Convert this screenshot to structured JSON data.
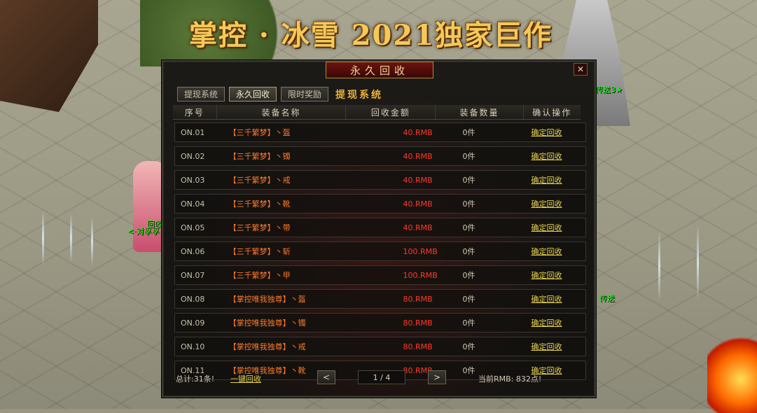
{
  "banner": "掌控 · 冰雪 2021独家巨作",
  "world": {
    "npc_left_label": "<·对孚孚>",
    "npc_left_label2": "回收",
    "npc_right_label": "传送",
    "npc_top_label": "传送3★"
  },
  "dialog": {
    "title": "永久回收",
    "close": "✕",
    "tabs": [
      "提现系统",
      "永久回收",
      "限时奖励"
    ],
    "section_title": "提现系统",
    "columns": [
      "序号",
      "装备名称",
      "回收金额",
      "装备数量",
      "确认操作"
    ],
    "rows": [
      {
        "no": "ON.01",
        "name": "【三千繁梦】丶盔",
        "amount": "40.RMB",
        "qty": "0件",
        "action": "确定回收"
      },
      {
        "no": "ON.02",
        "name": "【三千繁梦】丶镯",
        "amount": "40.RMB",
        "qty": "0件",
        "action": "确定回收"
      },
      {
        "no": "ON.03",
        "name": "【三千繁梦】丶戒",
        "amount": "40.RMB",
        "qty": "0件",
        "action": "确定回收"
      },
      {
        "no": "ON.04",
        "name": "【三千繁梦】丶靴",
        "amount": "40.RMB",
        "qty": "0件",
        "action": "确定回收"
      },
      {
        "no": "ON.05",
        "name": "【三千繁梦】丶带",
        "amount": "40.RMB",
        "qty": "0件",
        "action": "确定回收"
      },
      {
        "no": "ON.06",
        "name": "【三千繁梦】丶斩",
        "amount": "100.RMB",
        "qty": "0件",
        "action": "确定回收"
      },
      {
        "no": "ON.07",
        "name": "【三千繁梦】丶甲",
        "amount": "100.RMB",
        "qty": "0件",
        "action": "确定回收"
      },
      {
        "no": "ON.08",
        "name": "【掌控唯我独尊】丶盔",
        "amount": "80.RMB",
        "qty": "0件",
        "action": "确定回收"
      },
      {
        "no": "ON.09",
        "name": "【掌控唯我独尊】丶镯",
        "amount": "80.RMB",
        "qty": "0件",
        "action": "确定回收"
      },
      {
        "no": "ON.10",
        "name": "【掌控唯我独尊】丶戒",
        "amount": "80.RMB",
        "qty": "0件",
        "action": "确定回收"
      },
      {
        "no": "ON.11",
        "name": "【掌控唯我独尊】丶靴",
        "amount": "80.RMB",
        "qty": "0件",
        "action": "确定回收"
      }
    ],
    "footer": {
      "total": "总计:31条!",
      "one_click": "一键回收",
      "prev": "<",
      "page": "1 / 4",
      "next": ">",
      "rmb": "当前RMB: 832点!"
    }
  }
}
